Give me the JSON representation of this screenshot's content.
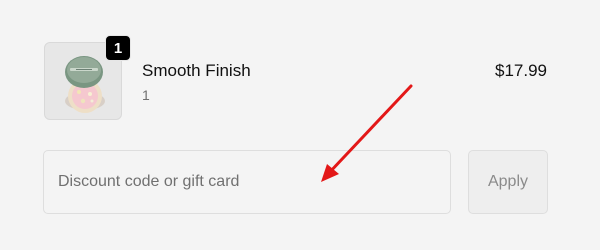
{
  "line_item": {
    "product_image_icon": "compact-powder-icon",
    "quantity_badge": "1",
    "name": "Smooth Finish",
    "variant": "1",
    "price": "$17.99"
  },
  "discount": {
    "placeholder": "Discount code or gift card",
    "apply_label": "Apply"
  },
  "annotation": {
    "arrow_color": "#e31818"
  }
}
